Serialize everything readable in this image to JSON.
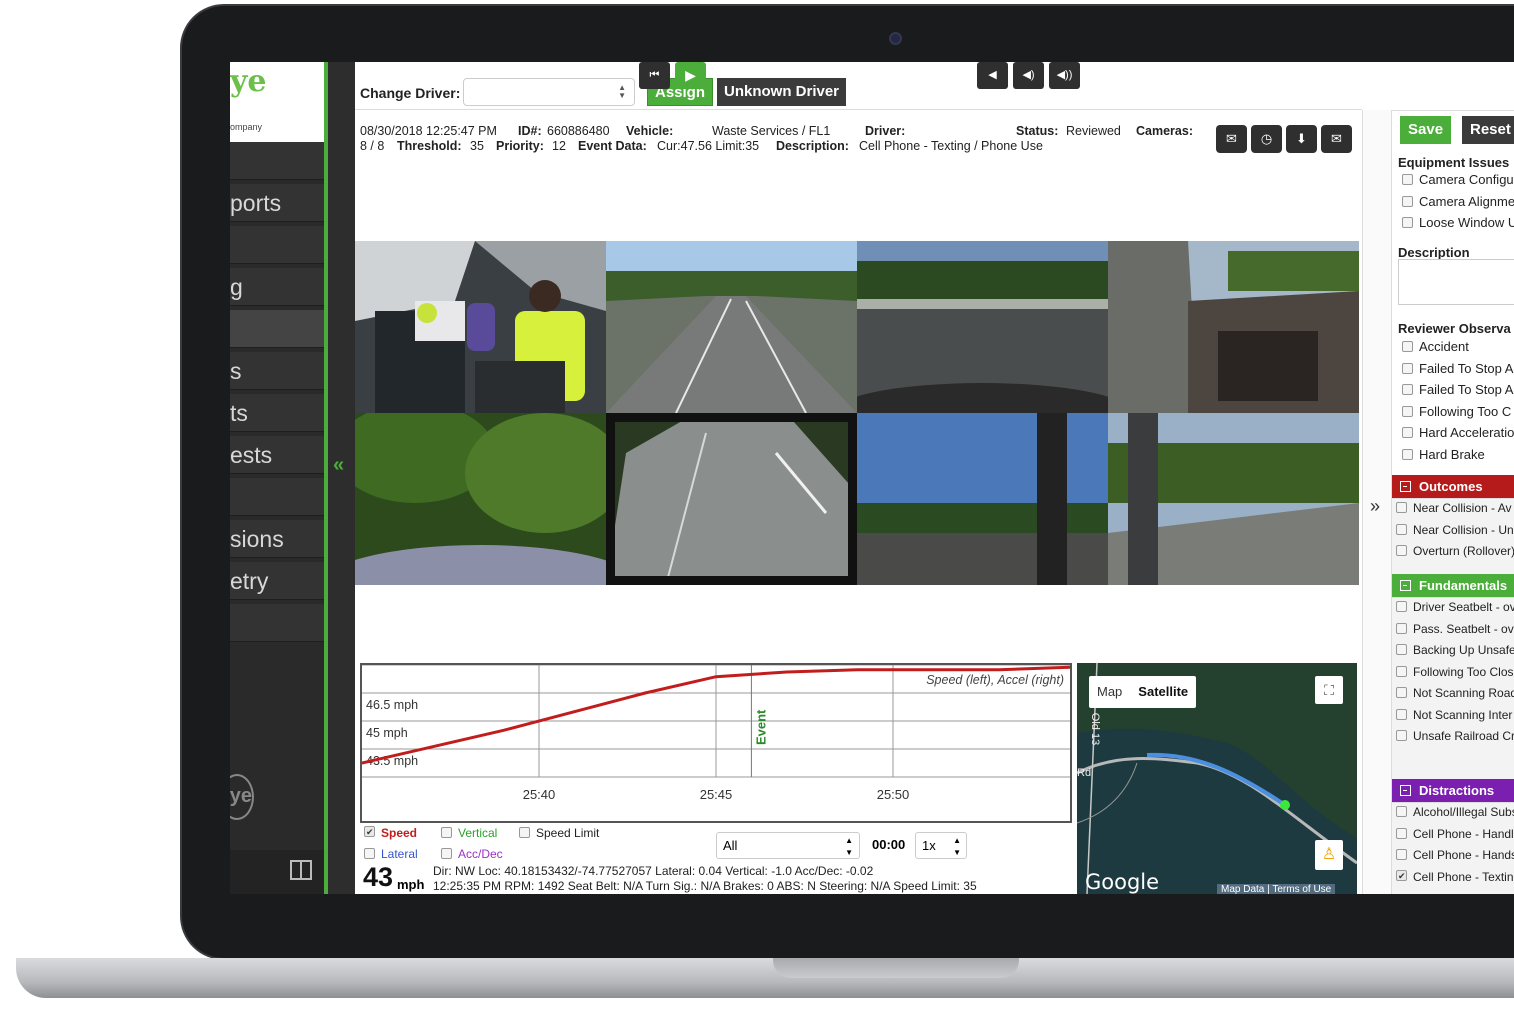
{
  "sidebar": {
    "logo_text": "ye",
    "logo_sub": "ompany",
    "items": [
      {
        "label": ""
      },
      {
        "label": "ports"
      },
      {
        "label": ""
      },
      {
        "label": "g"
      },
      {
        "label": ""
      },
      {
        "label": "s"
      },
      {
        "label": "ts"
      },
      {
        "label": "ests"
      },
      {
        "label": ""
      },
      {
        "label": "sions"
      },
      {
        "label": "etry"
      },
      {
        "label": ""
      }
    ],
    "bottom_logo": "ye"
  },
  "toolbar": {
    "change_driver_label": "Change Driver:",
    "driver_value": "",
    "assign_label": "Assign",
    "unknown_label": "Unknown Driver"
  },
  "event": {
    "datetime": "08/30/2018 12:25:47 PM",
    "id_label": "ID#:",
    "id": "660886480",
    "vehicle_label": "Vehicle:",
    "vehicle": "Waste Services / FL1",
    "driver_label": "Driver:",
    "driver": "",
    "status_label": "Status:",
    "status": "Reviewed",
    "cameras_label": "Cameras:",
    "cameras": "8 / 8",
    "threshold_label": "Threshold:",
    "threshold": "35",
    "priority_label": "Priority:",
    "priority": "12",
    "event_data_label": "Event Data:",
    "event_data": "Cur:47.56 Limit:35",
    "description_label": "Description:",
    "description": "Cell Phone - Texting / Phone Use"
  },
  "icons": [
    "comment-icon",
    "clock-icon",
    "download-icon",
    "email-icon"
  ],
  "chart_data": {
    "type": "line",
    "title": "Speed (left), Accel (right)",
    "xlabel": "",
    "ylabel": "",
    "x_ticks": [
      "25:40",
      "25:45",
      "25:50"
    ],
    "y_ticks": [
      "46.5 mph",
      "45 mph",
      "43.5 mph"
    ],
    "event_marker": {
      "label": "Event",
      "x": "25:46"
    },
    "series": [
      {
        "color": "#c21d1d",
        "x": [
          "25:35",
          "25:37",
          "25:39",
          "25:41",
          "25:43",
          "25:45",
          "25:47",
          "25:49",
          "25:51",
          "25:53",
          "25:55"
        ],
        "values": [
          43.6,
          44.3,
          45.0,
          45.8,
          46.6,
          47.3,
          47.5,
          47.6,
          47.6,
          47.6,
          47.7
        ]
      }
    ],
    "x_range": [
      "25:35",
      "25:55"
    ],
    "ylim": [
      43.0,
      47.8
    ]
  },
  "toggles": [
    {
      "label": "Speed",
      "checked": true,
      "color": "#c21d1d"
    },
    {
      "label": "Vertical",
      "checked": false,
      "color": "#2aa02a"
    },
    {
      "label": "Speed Limit",
      "checked": false,
      "color": "#222222"
    },
    {
      "label": "Lateral",
      "checked": false,
      "color": "#3355cc"
    },
    {
      "label": "Acc/Dec",
      "checked": false,
      "color": "#9b2fc9"
    }
  ],
  "player": {
    "filter": "All",
    "time": "00:00",
    "rate": "1x"
  },
  "telemetry": {
    "speed": "43",
    "unit": "mph",
    "line1": "Dir: NW  Loc: 40.18153432/-74.77527057  Lateral: 0.04  Vertical: -1.0  Acc/Dec: -0.02",
    "line2": "12:25:35 PM  RPM: 1492  Seat Belt: N/A  Turn Sig.: N/A  Brakes: 0  ABS: N  Steering: N/A  Speed Limit: 35"
  },
  "map": {
    "tab_map": "Map",
    "tab_satellite": "Satellite",
    "road1": "Old 13",
    "road2": "Rd",
    "brand": "Google",
    "legal1": "Map Data",
    "legal2": "Terms of Use"
  },
  "review": {
    "save": "Save",
    "reset": "Reset",
    "equipment_title": "Equipment Issues",
    "equipment": [
      {
        "label": "Camera Configu",
        "checked": false
      },
      {
        "label": "Camera Alignme",
        "checked": false
      },
      {
        "label": "Loose Window U",
        "checked": false
      }
    ],
    "description_title": "Description",
    "observations_title": "Reviewer Observa",
    "observations": [
      {
        "label": "Accident",
        "checked": false
      },
      {
        "label": "Failed To Stop A",
        "checked": false
      },
      {
        "label": "Failed To Stop A",
        "checked": false
      },
      {
        "label": "Following Too C",
        "checked": false
      },
      {
        "label": "Hard Acceleratio",
        "checked": false
      },
      {
        "label": "Hard Brake",
        "checked": false
      }
    ],
    "sections": [
      {
        "title": "Outcomes",
        "color": "#b51b1b",
        "items": [
          {
            "label": "Near Collision - Av",
            "checked": false
          },
          {
            "label": "Near Collision - Un",
            "checked": false
          },
          {
            "label": "Overturn (Rollover)",
            "checked": false
          }
        ]
      },
      {
        "title": "Fundamentals",
        "color": "#4cae3a",
        "items": [
          {
            "label": "Driver Seatbelt - ov",
            "checked": false
          },
          {
            "label": "Pass. Seatbelt - ov",
            "checked": false
          },
          {
            "label": "Backing Up Unsafe",
            "checked": false
          },
          {
            "label": "Following Too Clos",
            "checked": false
          },
          {
            "label": "Not Scanning Road",
            "checked": false
          },
          {
            "label": "Not Scanning Inter",
            "checked": false
          },
          {
            "label": "Unsafe Railroad Cr",
            "checked": false
          }
        ]
      },
      {
        "title": "Distractions",
        "color": "#7a1fb0",
        "items": [
          {
            "label": "Alcohol/Illegal Subs",
            "checked": false
          },
          {
            "label": "Cell Phone - Handl",
            "checked": false
          },
          {
            "label": "Cell Phone - Hands",
            "checked": false
          },
          {
            "label": "Cell Phone - Textin",
            "checked": true
          }
        ]
      }
    ]
  }
}
